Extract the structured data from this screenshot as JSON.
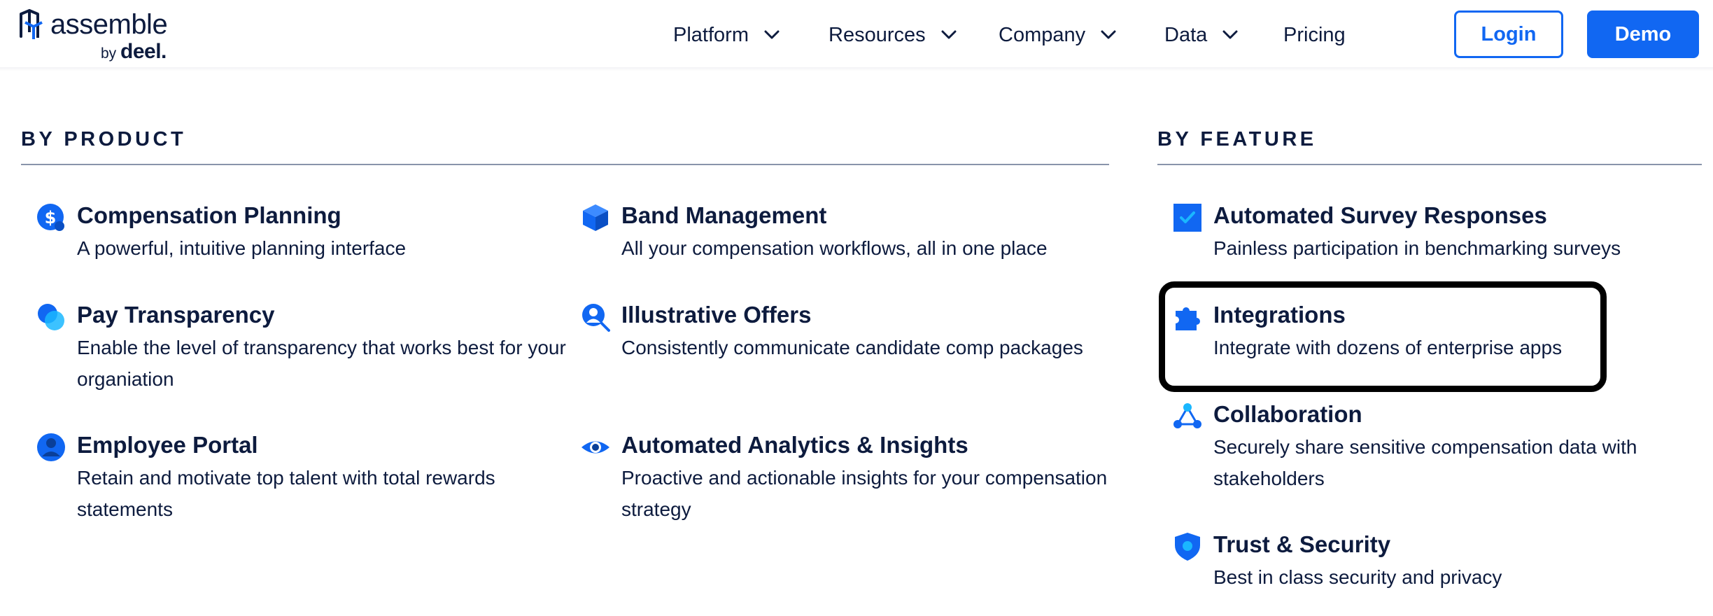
{
  "brand": {
    "name": "assemble",
    "by": "by",
    "parent": "deel."
  },
  "nav": {
    "platform": "Platform",
    "resources": "Resources",
    "company": "Company",
    "data": "Data",
    "pricing": "Pricing"
  },
  "actions": {
    "login": "Login",
    "demo": "Demo"
  },
  "by_product": {
    "heading": "BY PRODUCT",
    "items": [
      {
        "title": "Compensation Planning",
        "description": "A powerful, intuitive planning interface",
        "icon": "dollar-coin-icon"
      },
      {
        "title": "Band Management",
        "description": "All your compensation workflows, all in one place",
        "icon": "cube-icon"
      },
      {
        "title": "Pay Transparency",
        "description": "Enable the level of transparency that works best for your organiation",
        "icon": "overlap-circles-icon"
      },
      {
        "title": "Illustrative Offers",
        "description": "Consistently communicate candidate comp packages",
        "icon": "user-search-icon"
      },
      {
        "title": "Employee Portal",
        "description": "Retain and motivate top talent with total rewards statements",
        "icon": "user-circle-icon"
      },
      {
        "title": "Automated Analytics & Insights",
        "description": "Proactive and actionable insights for your compensation strategy",
        "icon": "eye-icon"
      }
    ]
  },
  "by_feature": {
    "heading": "BY FEATURE",
    "items": [
      {
        "title": "Automated Survey Responses",
        "description": "Painless participation in benchmarking surveys",
        "icon": "checkbox-icon"
      },
      {
        "title": "Integrations",
        "description": "Integrate with dozens of enterprise apps",
        "icon": "puzzle-icon"
      },
      {
        "title": "Collaboration",
        "description": "Securely share sensitive compensation data with stakeholders",
        "icon": "network-icon"
      },
      {
        "title": "Trust & Security",
        "description": "Best in class security and privacy",
        "icon": "shield-icon"
      }
    ]
  },
  "colors": {
    "brand_blue": "#1167f2",
    "text_navy": "#0d1b3e",
    "rule_gray": "#8994aa",
    "highlight": "#000000"
  }
}
